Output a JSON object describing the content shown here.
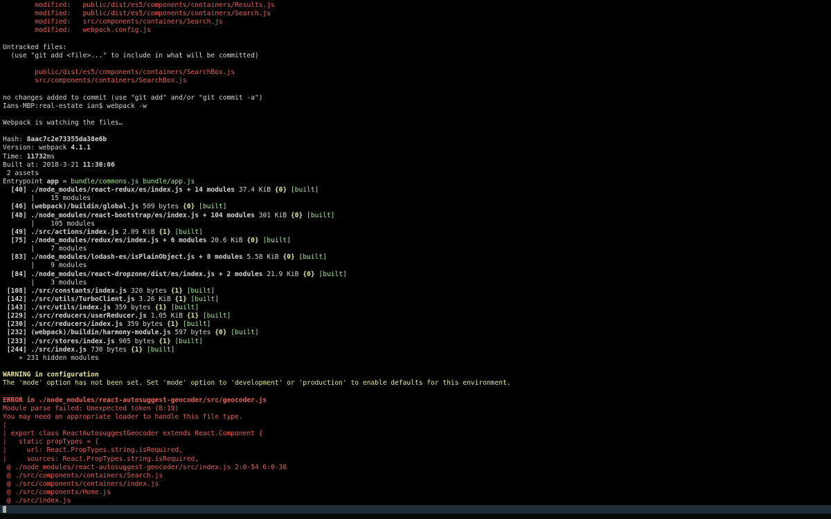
{
  "terminal": {
    "lines": [
      [
        {
          "t": "        modified:   ",
          "c": "red"
        },
        {
          "t": "public/dist/es5/components/containers/Results.js",
          "c": "red"
        }
      ],
      [
        {
          "t": "        modified:   ",
          "c": "red"
        },
        {
          "t": "public/dist/es5/components/containers/Search.js",
          "c": "red"
        }
      ],
      [
        {
          "t": "        modified:   ",
          "c": "red"
        },
        {
          "t": "src/components/containers/Search.js",
          "c": "red"
        }
      ],
      [
        {
          "t": "        modified:   ",
          "c": "red"
        },
        {
          "t": "webpack.config.js",
          "c": "red"
        }
      ],
      [],
      [
        {
          "t": "Untracked files:",
          "c": "white"
        }
      ],
      [
        {
          "t": "  (use \"git add <file>...\" to include in what will be committed)",
          "c": "white"
        }
      ],
      [],
      [
        {
          "t": "        public/dist/es5/components/containers/SearchBox.js",
          "c": "red"
        }
      ],
      [
        {
          "t": "        src/components/containers/SearchBox.js",
          "c": "red"
        }
      ],
      [],
      [
        {
          "t": "no changes added to commit (use \"git add\" and/or \"git commit -a\")",
          "c": "white"
        }
      ],
      [
        {
          "t": "Ians-MBP:real-estate ian$ webpack -w",
          "c": "white"
        }
      ],
      [],
      [
        {
          "t": "Webpack is watching the files…",
          "c": "white"
        }
      ],
      [],
      [
        {
          "t": "Hash: ",
          "c": "white"
        },
        {
          "t": "8aac7c2e73355da38e6b",
          "c": "white",
          "b": true
        }
      ],
      [
        {
          "t": "Version: webpack ",
          "c": "white"
        },
        {
          "t": "4.1.1",
          "c": "white",
          "b": true
        }
      ],
      [
        {
          "t": "Time: ",
          "c": "white"
        },
        {
          "t": "11732",
          "c": "white",
          "b": true
        },
        {
          "t": "ms",
          "c": "white"
        }
      ],
      [
        {
          "t": "Built at: 2018-3-21 ",
          "c": "white"
        },
        {
          "t": "11:30:06",
          "c": "white",
          "b": true
        }
      ],
      [
        {
          "t": " 2 assets",
          "c": "white"
        }
      ],
      [
        {
          "t": "Entrypoint ",
          "c": "white"
        },
        {
          "t": "app",
          "c": "white",
          "b": true
        },
        {
          "t": " = ",
          "c": "white"
        },
        {
          "t": "bundle/commons.js",
          "c": "green"
        },
        {
          "t": " ",
          "c": "white"
        },
        {
          "t": "bundle/app.js",
          "c": "green"
        }
      ],
      [
        {
          "t": "  [40] ",
          "c": "white",
          "b": true
        },
        {
          "t": "./node_modules/react-redux/es/index.js + 14 modules",
          "c": "white",
          "b": true
        },
        {
          "t": " 37.4 KiB ",
          "c": "white"
        },
        {
          "t": "{0}",
          "c": "yellow",
          "b": true
        },
        {
          "t": " ",
          "c": "white"
        },
        {
          "t": "[built]",
          "c": "green"
        }
      ],
      [
        {
          "t": "       |    15 modules",
          "c": "white"
        }
      ],
      [
        {
          "t": "  [46] ",
          "c": "white",
          "b": true
        },
        {
          "t": "(webpack)/buildin/global.js",
          "c": "white",
          "b": true
        },
        {
          "t": " 509 bytes ",
          "c": "white"
        },
        {
          "t": "{0}",
          "c": "yellow",
          "b": true
        },
        {
          "t": " ",
          "c": "white"
        },
        {
          "t": "[built]",
          "c": "green"
        }
      ],
      [
        {
          "t": "  [48] ",
          "c": "white",
          "b": true
        },
        {
          "t": "./node_modules/react-bootstrap/es/index.js + 104 modules",
          "c": "white",
          "b": true
        },
        {
          "t": " 301 KiB ",
          "c": "white"
        },
        {
          "t": "{0}",
          "c": "yellow",
          "b": true
        },
        {
          "t": " ",
          "c": "white"
        },
        {
          "t": "[built]",
          "c": "green"
        }
      ],
      [
        {
          "t": "       |    105 modules",
          "c": "white"
        }
      ],
      [
        {
          "t": "  [49] ",
          "c": "white",
          "b": true
        },
        {
          "t": "./src/actions/index.js",
          "c": "white",
          "b": true
        },
        {
          "t": " 2.09 KiB ",
          "c": "white"
        },
        {
          "t": "{1}",
          "c": "yellow",
          "b": true
        },
        {
          "t": " ",
          "c": "white"
        },
        {
          "t": "[built]",
          "c": "green"
        }
      ],
      [
        {
          "t": "  [75] ",
          "c": "white",
          "b": true
        },
        {
          "t": "./node_modules/redux/es/index.js + 6 modules",
          "c": "white",
          "b": true
        },
        {
          "t": " 20.6 KiB ",
          "c": "white"
        },
        {
          "t": "{0}",
          "c": "yellow",
          "b": true
        },
        {
          "t": " ",
          "c": "white"
        },
        {
          "t": "[built]",
          "c": "green"
        }
      ],
      [
        {
          "t": "       |    7 modules",
          "c": "white"
        }
      ],
      [
        {
          "t": "  [83] ",
          "c": "white",
          "b": true
        },
        {
          "t": "./node_modules/lodash-es/isPlainObject.js + 8 modules",
          "c": "white",
          "b": true
        },
        {
          "t": " 5.58 KiB ",
          "c": "white"
        },
        {
          "t": "{0}",
          "c": "yellow",
          "b": true
        },
        {
          "t": " ",
          "c": "white"
        },
        {
          "t": "[built]",
          "c": "green"
        }
      ],
      [
        {
          "t": "       |    9 modules",
          "c": "white"
        }
      ],
      [
        {
          "t": "  [84] ",
          "c": "white",
          "b": true
        },
        {
          "t": "./node_modules/react-dropzone/dist/es/index.js + 2 modules",
          "c": "white",
          "b": true
        },
        {
          "t": " 21.9 KiB ",
          "c": "white"
        },
        {
          "t": "{0}",
          "c": "yellow",
          "b": true
        },
        {
          "t": " ",
          "c": "white"
        },
        {
          "t": "[built]",
          "c": "green"
        }
      ],
      [
        {
          "t": "       |    3 modules",
          "c": "white"
        }
      ],
      [
        {
          "t": " [108] ",
          "c": "white",
          "b": true
        },
        {
          "t": "./src/constants/index.js",
          "c": "white",
          "b": true
        },
        {
          "t": " 320 bytes ",
          "c": "white"
        },
        {
          "t": "{1}",
          "c": "yellow",
          "b": true
        },
        {
          "t": " ",
          "c": "white"
        },
        {
          "t": "[built]",
          "c": "green"
        }
      ],
      [
        {
          "t": " [142] ",
          "c": "white",
          "b": true
        },
        {
          "t": "./src/utils/TurboClient.js",
          "c": "white",
          "b": true
        },
        {
          "t": " 3.26 KiB ",
          "c": "white"
        },
        {
          "t": "{1}",
          "c": "yellow",
          "b": true
        },
        {
          "t": " ",
          "c": "white"
        },
        {
          "t": "[built]",
          "c": "green"
        }
      ],
      [
        {
          "t": " [143] ",
          "c": "white",
          "b": true
        },
        {
          "t": "./src/utils/index.js",
          "c": "white",
          "b": true
        },
        {
          "t": " 359 bytes ",
          "c": "white"
        },
        {
          "t": "{1}",
          "c": "yellow",
          "b": true
        },
        {
          "t": " ",
          "c": "white"
        },
        {
          "t": "[built]",
          "c": "green"
        }
      ],
      [
        {
          "t": " [229] ",
          "c": "white",
          "b": true
        },
        {
          "t": "./src/reducers/userReducer.js",
          "c": "white",
          "b": true
        },
        {
          "t": " 1.05 KiB ",
          "c": "white"
        },
        {
          "t": "{1}",
          "c": "yellow",
          "b": true
        },
        {
          "t": " ",
          "c": "white"
        },
        {
          "t": "[built]",
          "c": "green"
        }
      ],
      [
        {
          "t": " [230] ",
          "c": "white",
          "b": true
        },
        {
          "t": "./src/reducers/index.js",
          "c": "white",
          "b": true
        },
        {
          "t": " 359 bytes ",
          "c": "white"
        },
        {
          "t": "{1}",
          "c": "yellow",
          "b": true
        },
        {
          "t": " ",
          "c": "white"
        },
        {
          "t": "[built]",
          "c": "green"
        }
      ],
      [
        {
          "t": " [232] ",
          "c": "white",
          "b": true
        },
        {
          "t": "(webpack)/buildin/harmony-module.js",
          "c": "white",
          "b": true
        },
        {
          "t": " 597 bytes ",
          "c": "white"
        },
        {
          "t": "{0}",
          "c": "yellow",
          "b": true
        },
        {
          "t": " ",
          "c": "white"
        },
        {
          "t": "[built]",
          "c": "green"
        }
      ],
      [
        {
          "t": " [233] ",
          "c": "white",
          "b": true
        },
        {
          "t": "./src/stores/index.js",
          "c": "white",
          "b": true
        },
        {
          "t": " 905 bytes ",
          "c": "white"
        },
        {
          "t": "{1}",
          "c": "yellow",
          "b": true
        },
        {
          "t": " ",
          "c": "white"
        },
        {
          "t": "[built]",
          "c": "green"
        }
      ],
      [
        {
          "t": " [244] ",
          "c": "white",
          "b": true
        },
        {
          "t": "./src/index.js",
          "c": "white",
          "b": true
        },
        {
          "t": " 730 bytes ",
          "c": "white"
        },
        {
          "t": "{1}",
          "c": "yellow",
          "b": true
        },
        {
          "t": " ",
          "c": "white"
        },
        {
          "t": "[built]",
          "c": "green"
        }
      ],
      [
        {
          "t": "    + 231 hidden modules",
          "c": "white"
        }
      ],
      [],
      [
        {
          "t": "WARNING in configuration",
          "c": "yellow",
          "b": true
        }
      ],
      [
        {
          "t": "The 'mode' option has not been set. Set 'mode' option to 'development' or 'production' to enable defaults for this environment.",
          "c": "yellow"
        }
      ],
      [],
      [
        {
          "t": "ERROR in ./node_modules/react-autosuggest-geocoder/src/geocoder.js",
          "c": "red",
          "b": true
        }
      ],
      [
        {
          "t": "Module parse failed: Unexpected token (8:19)",
          "c": "red"
        }
      ],
      [
        {
          "t": "You may need an appropriate loader to handle this file type.",
          "c": "red"
        }
      ],
      [
        {
          "t": "|",
          "c": "red"
        }
      ],
      [
        {
          "t": "| export class ReactAutosuggestGeocoder extends React.Component {",
          "c": "red"
        }
      ],
      [
        {
          "t": "|   static propTypes = {",
          "c": "red"
        }
      ],
      [
        {
          "t": "|     url: React.PropTypes.string.isRequired,",
          "c": "red"
        }
      ],
      [
        {
          "t": "|     sources: React.PropTypes.string.isRequired,",
          "c": "red"
        }
      ],
      [
        {
          "t": " @ ./node_modules/react-autosuggest-geocoder/src/index.js 2:0-54 6:0-36",
          "c": "red"
        }
      ],
      [
        {
          "t": " @ ./src/components/containers/Search.js",
          "c": "red"
        }
      ],
      [
        {
          "t": " @ ./src/components/containers/index.js",
          "c": "red"
        }
      ],
      [
        {
          "t": " @ ./src/components/Home.js",
          "c": "red"
        }
      ],
      [
        {
          "t": " @ ./src/index.js",
          "c": "red"
        }
      ]
    ]
  },
  "colors": {
    "background": "#000000",
    "white": "#d6d6d6",
    "red": "#e4625b",
    "green": "#a7e89a",
    "yellow": "#e6e6a0",
    "status_bar": "#1e2c33",
    "cursor": "#b0b0b0"
  }
}
